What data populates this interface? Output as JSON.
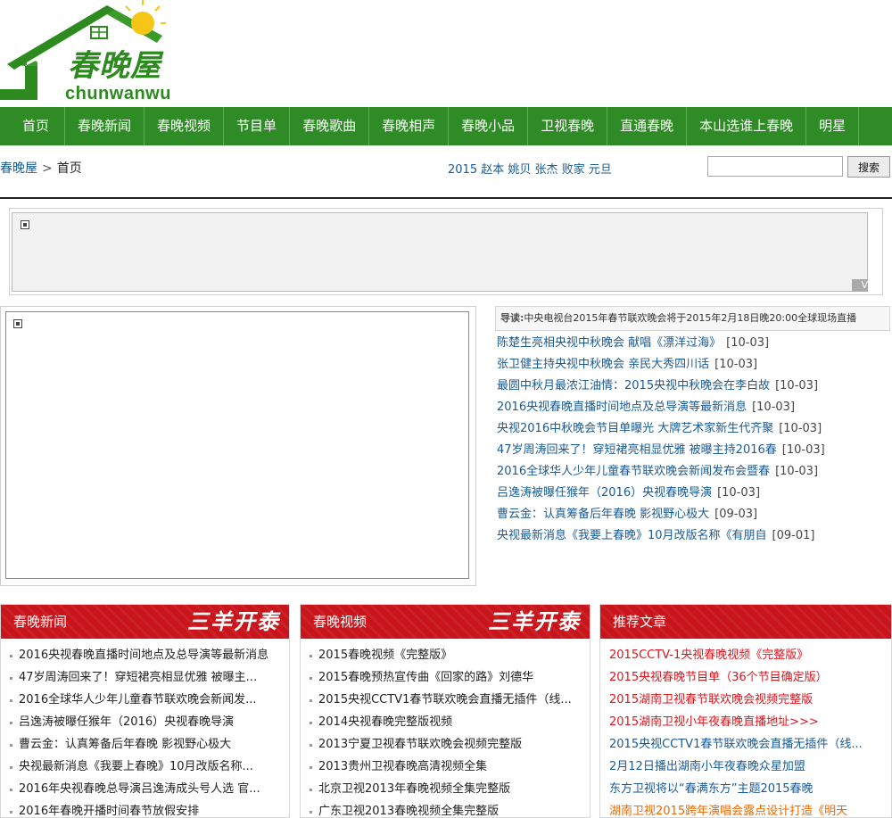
{
  "header": {
    "logo_text": "春晚屋",
    "logo_sub": "chunwanwu"
  },
  "nav": [
    "首页",
    "春晚新闻",
    "春晚视频",
    "节目单",
    "春晚歌曲",
    "春晚相声",
    "春晚小品",
    "卫视春晚",
    "直通春晚",
    "本山选谁上春晚",
    "明星"
  ],
  "breadcrumb": {
    "site": "春晚屋",
    "separator": ">",
    "current": "首页"
  },
  "tags": [
    "2015",
    "赵本",
    "姚贝",
    "张杰",
    "败家",
    "元旦"
  ],
  "search": {
    "value": "",
    "button": "搜索"
  },
  "ad": {
    "corner": "V"
  },
  "lead": {
    "label": "导读:",
    "text": "中央电视台2015年春节联欢晚会将于2015年2月18日晚20:00全球现场直播"
  },
  "headlines": [
    {
      "title": "陈楚生亮相央视中秋晚会 献唱《漂洋过海》",
      "date": "[10-03]"
    },
    {
      "title": "张卫健主持央视中秋晚会 亲民大秀四川话",
      "date": "[10-03]"
    },
    {
      "title": "最圆中秋月最浓江油情：2015央视中秋晚会在李白故",
      "date": "[10-03]"
    },
    {
      "title": "2016央视春晚直播时间地点及总导演等最新消息",
      "date": "[10-03]"
    },
    {
      "title": "央视2016中秋晚会节目单曝光 大牌艺术家新生代齐聚",
      "date": "[10-03]"
    },
    {
      "title": "47岁周涛回来了！穿短裙亮相显优雅 被曝主持2016春",
      "date": "[10-03]"
    },
    {
      "title": "2016全球华人少年儿童春节联欢晚会新闻发布会暨春",
      "date": "[10-03]"
    },
    {
      "title": "吕逸涛被曝任猴年（2016）央视春晚导演",
      "date": "[10-03]"
    },
    {
      "title": "曹云金：认真筹备后年春晚 影视野心极大",
      "date": "[09-03]"
    },
    {
      "title": "央视最新消息《我要上春晚》10月改版名称《有朋自",
      "date": "[09-01]"
    }
  ],
  "panels": {
    "news": {
      "title": "春晚新闻",
      "deco": "三羊开泰",
      "items": [
        "2016央视春晚直播时间地点及总导演等最新消息",
        "47岁周涛回来了！穿短裙亮相显优雅 被曝主...",
        "2016全球华人少年儿童春节联欢晚会新闻发...",
        "吕逸涛被曝任猴年（2016）央视春晚导演",
        "曹云金：认真筹备后年春晚 影视野心极大",
        "央视最新消息《我要上春晚》10月改版名称...",
        "2016年央视春晚总导演吕逸涛成头号人选 官...",
        "2016年春晚开播时间春节放假安排"
      ]
    },
    "video": {
      "title": "春晚视频",
      "deco": "三羊开泰",
      "items": [
        "2015春晚视频《完整版》",
        "2015春晚预热宣传曲《回家的路》刘德华",
        "2015央视CCTV1春节联欢晚会直播无插件（线...",
        "2014央视春晚完整版视频",
        "2013宁夏卫视春节联欢晚会视频完整版",
        "2013贵州卫视春晚高清视频全集",
        "北京卫视2013年春晚视频全集完整版",
        "广东卫视2013春晚视频全集完整版"
      ]
    },
    "recommend": {
      "title": "推荐文章",
      "items": [
        {
          "text": "2015CCTV-1央视春晚视频《完整版》",
          "color": "red"
        },
        {
          "text": "2015央视春晚节目单（36个节目确定版）",
          "color": "red"
        },
        {
          "text": "2015湖南卫视春节联欢晚会视频完整版",
          "color": "red"
        },
        {
          "text": "2015湖南卫视小年夜春晚直播地址>>>",
          "color": "red"
        },
        {
          "text": "2015央视CCTV1春节联欢晚会直播无插件（线...",
          "color": "blue"
        },
        {
          "text": "2月12日播出湖南小年夜春晚众星加盟",
          "color": "blue"
        },
        {
          "text": "东方卫视将以“春满东方”主题2015春晚",
          "color": "blue"
        },
        {
          "text": "湖南卫视2015跨年演唱会露点设计打造《明天",
          "color": "orange"
        }
      ]
    }
  }
}
